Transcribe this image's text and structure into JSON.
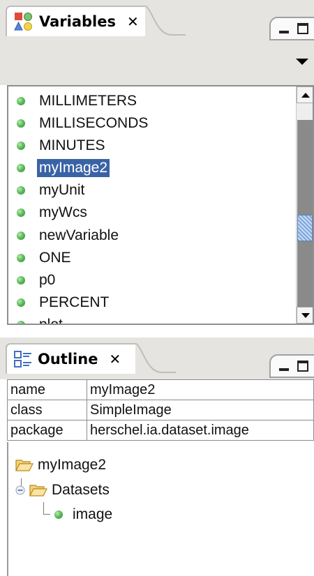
{
  "variables_view": {
    "title": "Variables",
    "close": "✕",
    "items": [
      {
        "label": "MILLIMETERS"
      },
      {
        "label": "MILLISECONDS"
      },
      {
        "label": "MINUTES"
      },
      {
        "label": "myImage2",
        "selected": true
      },
      {
        "label": "myUnit"
      },
      {
        "label": "myWcs"
      },
      {
        "label": "newVariable"
      },
      {
        "label": "ONE"
      },
      {
        "label": "p0"
      },
      {
        "label": "PERCENT"
      },
      {
        "label": "plot"
      }
    ],
    "selection_color": "#3a63a6",
    "variable_dot_color": "#5dbd5a"
  },
  "outline_view": {
    "title": "Outline",
    "close": "✕",
    "properties": [
      {
        "key": "name",
        "value": "myImage2"
      },
      {
        "key": "class",
        "value": "SimpleImage"
      },
      {
        "key": "package",
        "value": "herschel.ia.dataset.image"
      }
    ],
    "tree": {
      "root": "myImage2",
      "child": "Datasets",
      "leaf": "image"
    }
  }
}
